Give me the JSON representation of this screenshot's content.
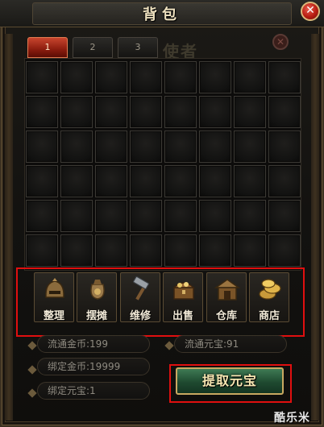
{
  "window": {
    "title": "背包",
    "close_glyph": "✕"
  },
  "tabs": [
    {
      "label": "1",
      "active": true
    },
    {
      "label": "2",
      "active": false
    },
    {
      "label": "3",
      "active": false
    }
  ],
  "background_text": "使者",
  "ghost_close_glyph": "✕",
  "grid": {
    "rows": 6,
    "cols": 8
  },
  "toolbar": {
    "items": [
      {
        "label": "整理",
        "icon": "helmet-icon"
      },
      {
        "label": "摆摊",
        "icon": "money-bag-icon"
      },
      {
        "label": "维修",
        "icon": "hammer-icon"
      },
      {
        "label": "出售",
        "icon": "treasure-chest-icon"
      },
      {
        "label": "仓库",
        "icon": "warehouse-icon"
      },
      {
        "label": "商店",
        "icon": "gold-coins-icon"
      }
    ]
  },
  "currency": {
    "circulating_gold": {
      "label": "流通金币:",
      "value": "199"
    },
    "circulating_yuanbao": {
      "label": "流通元宝:",
      "value": "91"
    },
    "bound_gold": {
      "label": "绑定金币:",
      "value": "19999"
    },
    "bound_yuanbao": {
      "label": "绑定元宝:",
      "value": "1"
    }
  },
  "withdraw_button_label": "提取元宝",
  "watermark": "酷乐米",
  "colors": {
    "highlight": "#e00f0f",
    "accent_gold": "#c9a961",
    "tab_active": "#b8321c"
  }
}
